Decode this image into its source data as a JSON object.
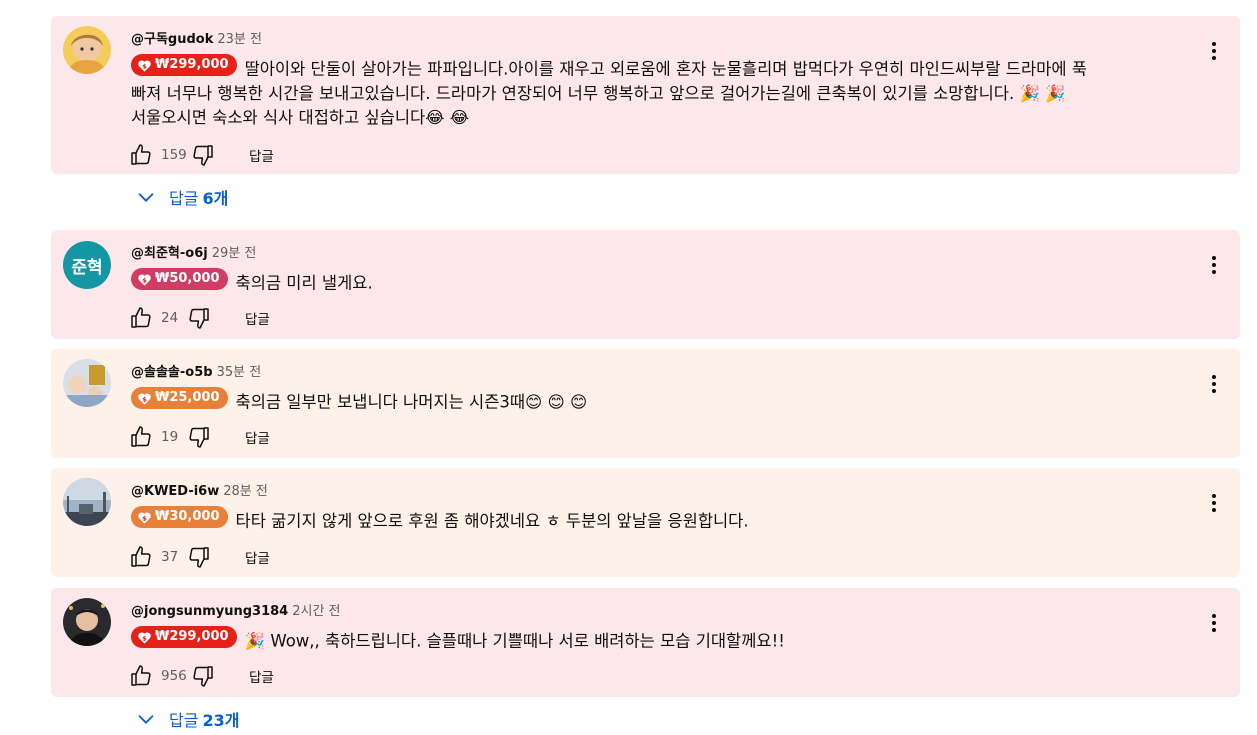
{
  "comments": [
    {
      "handle": "@구독gudok",
      "time": "23분 전",
      "amount": "₩299,000",
      "chip_color": "#e62117",
      "lines": [
        "딸아이와 단둘이 살아가는 파파입니다.아이를 재우고 외로움에 혼자 눈물흘리며 밥먹다가 우연히 마인드씨부랄 드라마에 푹",
        "빠져 너무나 행복한 시간을 보내고있습니다. 드라마가 연장되어 너무 행복하고 앞으로 걸어가는길에 큰축복이 있기를 소망합니다. 🎉 🎉",
        "서울오시면 숙소와 식사 대접하고 싶습니다😂 😂"
      ],
      "likes": "159",
      "reply_label": "답글"
    },
    {
      "handle": "@최준혁-o6j",
      "time": "29분 전",
      "avatar_text": "준혁",
      "amount": "₩50,000",
      "chip_color": "#d33c62",
      "lines": [
        "축의금 미리 낼게요."
      ],
      "likes": "24",
      "reply_label": "답글"
    },
    {
      "handle": "@솔솔솔-o5b",
      "time": "35분 전",
      "amount": "₩25,000",
      "chip_color": "#e8803a",
      "lines": [
        "축의금 일부만 보냅니다 나머지는 시즌3때😊 😊 😊"
      ],
      "likes": "19",
      "reply_label": "답글"
    },
    {
      "handle": "@KWED-i6w",
      "time": "28분 전",
      "amount": "₩30,000",
      "chip_color": "#e8803a",
      "lines": [
        "타타 굶기지 않게 앞으로 후원 좀 해야겠네요 ㅎ 두분의 앞날을 응원합니다."
      ],
      "likes": "37",
      "reply_label": "답글"
    },
    {
      "handle": "@jongsunmyung3184",
      "time": "2시간 전",
      "amount": "₩299,000",
      "chip_color": "#e62117",
      "lines": [
        "🎉  Wow,, 축하드립니다. 슬플때나 기쁠때나 서로 배려하는 모습 기대할께요!!"
      ],
      "likes": "956",
      "reply_label": "답글"
    }
  ],
  "reply_toggles": [
    {
      "prefix": "답글",
      "count": "6개"
    },
    {
      "prefix": "답글",
      "count": "23개"
    }
  ],
  "icons": {
    "like": "thumb-up-icon",
    "dislike": "thumb-down-icon",
    "menu": "more-vert-icon",
    "chevron": "chevron-down-icon",
    "chip": "heart-dollar-icon"
  },
  "colors": {
    "pink_card": "#fce8ea",
    "peach_card": "#fdf1e8",
    "link_blue": "#065fd4"
  }
}
